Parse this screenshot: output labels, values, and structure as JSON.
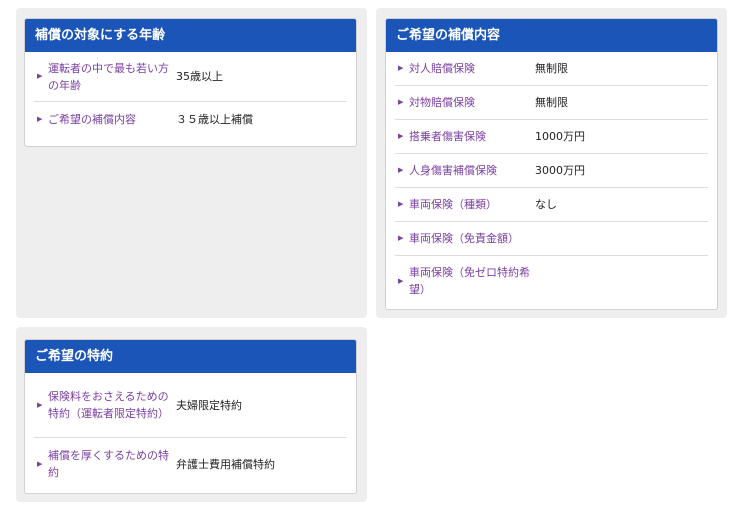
{
  "panel_age": {
    "title": "補償の対象にする年齢",
    "rows": [
      {
        "label": "運転者の中で最も若い方の年齢",
        "value": "35歳以上"
      },
      {
        "label": "ご希望の補償内容",
        "value": "３５歳以上補償"
      }
    ]
  },
  "panel_coverage": {
    "title": "ご希望の補償内容",
    "rows": [
      {
        "label": "対人賠償保険",
        "value": "無制限"
      },
      {
        "label": "対物賠償保険",
        "value": "無制限"
      },
      {
        "label": "搭乗者傷害保険",
        "value": "1000万円"
      },
      {
        "label": "人身傷害補償保険",
        "value": "3000万円"
      },
      {
        "label": "車両保険（種類）",
        "value": "なし"
      },
      {
        "label": "車両保険（免責金額）",
        "value": ""
      },
      {
        "label": "車両保険（免ゼロ特約希望）",
        "value": ""
      }
    ]
  },
  "panel_special": {
    "title": "ご希望の特約",
    "rows": [
      {
        "label": "保険料をおさえるための特約（運転者限定特約）",
        "value": "夫婦限定特約"
      },
      {
        "label": "補償を厚くするための特約",
        "value": "弁護士費用補償特約"
      }
    ]
  },
  "icons": {
    "row_bullet": "triangle-right-icon"
  }
}
